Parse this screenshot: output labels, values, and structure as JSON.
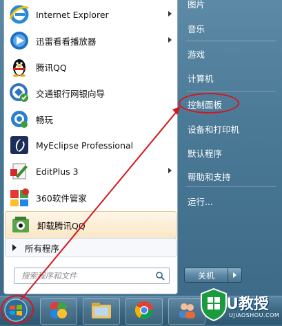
{
  "left_items": [
    {
      "label": "Internet Explorer",
      "icon": "internet-explorer-icon",
      "has_submenu": true
    },
    {
      "label": "迅雷看看播放器",
      "icon": "xunlei-player-icon",
      "has_submenu": true
    },
    {
      "label": "腾讯QQ",
      "icon": "qq-penguin-icon",
      "has_submenu": false
    },
    {
      "label": "交通银行网银向导",
      "icon": "bank-guide-icon",
      "has_submenu": false
    },
    {
      "label": "畅玩",
      "icon": "changwan-icon",
      "has_submenu": false
    },
    {
      "label": "MyEclipse Professional",
      "icon": "myeclipse-icon",
      "has_submenu": false
    },
    {
      "label": "EditPlus 3",
      "icon": "editplus-icon",
      "has_submenu": true
    },
    {
      "label": "360软件管家",
      "icon": "360-software-manager-icon",
      "has_submenu": false
    },
    {
      "label": "卸载腾讯QQ",
      "icon": "uninstall-qq-icon",
      "has_submenu": false
    }
  ],
  "all_programs": "所有程序",
  "search": {
    "placeholder": "搜索程序和文件"
  },
  "right_items": [
    "图片",
    "音乐",
    "游戏",
    "计算机",
    "控制面板",
    "设备和打印机",
    "默认程序",
    "帮助和支持",
    "运行..."
  ],
  "shutdown": {
    "label": "关机"
  },
  "taskbar": {
    "apps": [
      "start-orb-icon",
      "pinwheel-app-icon",
      "file-explorer-icon",
      "chrome-icon",
      "contacts-icon"
    ]
  },
  "watermark": {
    "text": "U教授",
    "sub": "UJIAOSHOU.COM"
  },
  "colors": {
    "annotation_red": "#d3171d",
    "highlight": "#fbe7c3"
  }
}
